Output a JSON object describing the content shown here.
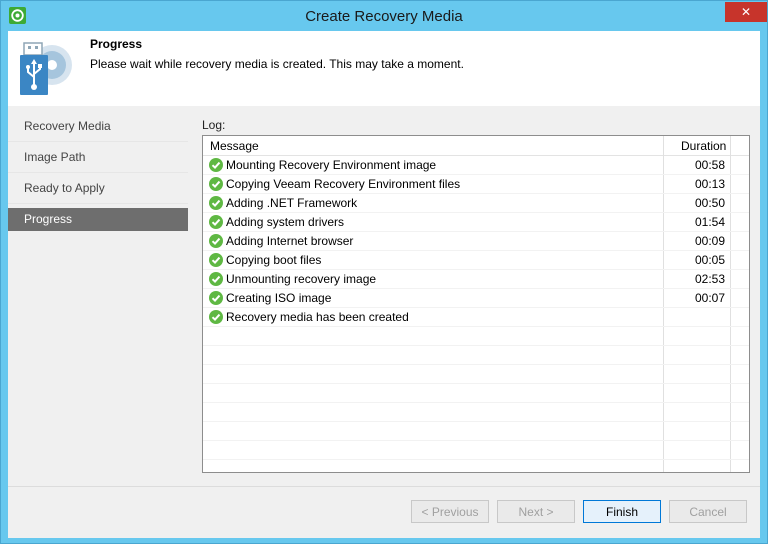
{
  "window": {
    "title": "Create Recovery Media",
    "close_glyph": "✕"
  },
  "header": {
    "title": "Progress",
    "description": "Please wait while recovery media is created. This may take a moment.",
    "icon": "usb-disc-icon"
  },
  "nav": {
    "items": [
      {
        "label": "Recovery Media",
        "active": false
      },
      {
        "label": "Image Path",
        "active": false
      },
      {
        "label": "Ready to Apply",
        "active": false
      },
      {
        "label": "Progress",
        "active": true
      }
    ]
  },
  "log": {
    "label": "Log:",
    "columns": {
      "message": "Message",
      "duration": "Duration"
    },
    "rows": [
      {
        "message": "Mounting Recovery Environment image",
        "duration": "00:58"
      },
      {
        "message": "Copying Veeam Recovery Environment files",
        "duration": "00:13"
      },
      {
        "message": "Adding .NET Framework",
        "duration": "00:50"
      },
      {
        "message": "Adding system drivers",
        "duration": "01:54"
      },
      {
        "message": "Adding Internet browser",
        "duration": "00:09"
      },
      {
        "message": "Copying boot files",
        "duration": "00:05"
      },
      {
        "message": "Unmounting recovery image",
        "duration": "02:53"
      },
      {
        "message": "Creating ISO image",
        "duration": "00:07"
      },
      {
        "message": "Recovery media has been created",
        "duration": ""
      }
    ]
  },
  "buttons": {
    "previous": "< Previous",
    "next": "Next >",
    "finish": "Finish",
    "cancel": "Cancel"
  },
  "colors": {
    "titlebar": "#67c8ee",
    "close": "#c7342b",
    "active_nav": "#6e6e6e",
    "success": "#5fb843"
  }
}
